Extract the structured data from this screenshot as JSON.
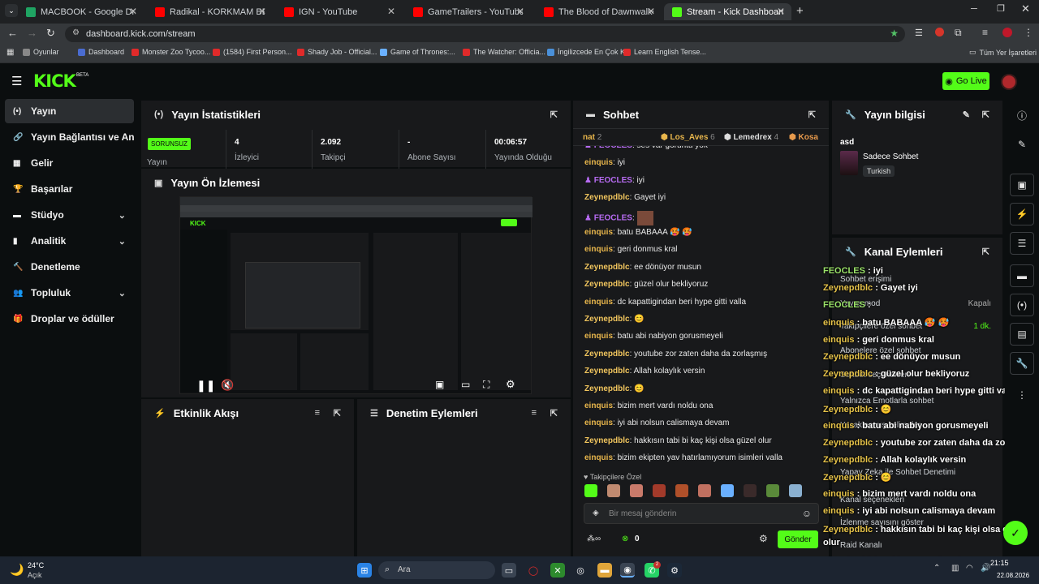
{
  "browser": {
    "tabs": [
      {
        "label": "MACBOOK - Google Drive",
        "color": "#1fa463"
      },
      {
        "label": "Radikal - KORKMAM BEN - You",
        "color": "#ff0000"
      },
      {
        "label": "IGN - YouTube",
        "color": "#ff0000"
      },
      {
        "label": "GameTrailers - YouTube",
        "color": "#ff0000"
      },
      {
        "label": "The Blood of Dawnwalker - Off",
        "color": "#ff0000"
      },
      {
        "label": "Stream - Kick Dashboard",
        "color": "#53fc18"
      }
    ],
    "url": "dashboard.kick.com/stream",
    "bookmarks": [
      "Oyunlar",
      "Dashboard",
      "Monster Zoo Tycoo...",
      "(1584) First Person...",
      "Shady Job - Official...",
      "Game of Thrones:...",
      "The Watcher: Officia...",
      "İngilizcede En Çok K...",
      "Learn English Tense..."
    ],
    "all_bookmarks": "Tüm Yer İşaretleri"
  },
  "kick": {
    "logo": "KICK",
    "logo_sup": "BETA",
    "go_live": "Go Live",
    "accent": "#53fc18"
  },
  "sidebar": {
    "items": [
      {
        "label": "Yayın",
        "icon": "broadcast-icon",
        "chev": false
      },
      {
        "label": "Yayın Bağlantısı ve Anahtar",
        "icon": "link-icon",
        "chev": false
      },
      {
        "label": "Gelir",
        "icon": "revenue-icon",
        "chev": false
      },
      {
        "label": "Başarılar",
        "icon": "trophy-icon",
        "chev": false
      },
      {
        "label": "Stüdyo",
        "icon": "studio-icon",
        "chev": true
      },
      {
        "label": "Analitik",
        "icon": "analytics-icon",
        "chev": true
      },
      {
        "label": "Denetleme",
        "icon": "hammer-icon",
        "chev": false
      },
      {
        "label": "Topluluk",
        "icon": "community-icon",
        "chev": true
      },
      {
        "label": "Droplar ve ödüller",
        "icon": "gift-icon",
        "chev": false
      }
    ]
  },
  "stats": {
    "title": "Yayın İstatistikleri",
    "status_badge": "SORUNSUZ",
    "status_label": "Yayın",
    "items": [
      {
        "value": "4",
        "label": "İzleyici"
      },
      {
        "value": "2.092",
        "label": "Takipçi"
      },
      {
        "value": "-",
        "label": "Abone Sayısı"
      },
      {
        "value": "00:06:57",
        "label": "Yayında Olduğu"
      }
    ]
  },
  "preview": {
    "title": "Yayın Ön İzlemesi"
  },
  "activity": {
    "title": "Etkinlik Akışı"
  },
  "moderation": {
    "title": "Denetim Eylemleri"
  },
  "chat": {
    "title": "Sohbet",
    "top_gifters": [
      {
        "name": "nat",
        "count": "2"
      },
      {
        "name": "Los_Aves",
        "count": "6"
      },
      {
        "name": "Lemedrex",
        "count": "4"
      },
      {
        "name": "Kosa",
        "count": ""
      }
    ],
    "messages": [
      {
        "user": "FEOCLES",
        "text": "ses var görüntü yok",
        "badge": true
      },
      {
        "user": "einquis",
        "text": "iyi",
        "badge": false
      },
      {
        "user": "FEOCLES",
        "text": "iyi",
        "badge": true
      },
      {
        "user": "Zeynepdblc",
        "text": "Gayet iyi",
        "badge": false
      },
      {
        "user": "FEOCLES",
        "text": "",
        "badge": true,
        "emote": true
      },
      {
        "user": "einquis",
        "text": "batu BABAAA 🥵 🥵",
        "badge": false
      },
      {
        "user": "einquis",
        "text": "geri donmus kral",
        "badge": false
      },
      {
        "user": "Zeynepdblc",
        "text": "ee dönüyor musun",
        "badge": false
      },
      {
        "user": "Zeynepdblc",
        "text": "güzel olur bekliyoruz",
        "badge": false
      },
      {
        "user": "einquis",
        "text": "dc kapattigindan beri hype gitti valla",
        "badge": false
      },
      {
        "user": "Zeynepdblc",
        "text": "😊",
        "badge": false
      },
      {
        "user": "einquis",
        "text": "batu abi nabiyon gorusmeyeli",
        "badge": false
      },
      {
        "user": "Zeynepdblc",
        "text": "youtube zor zaten daha da zorlaşmış",
        "badge": false
      },
      {
        "user": "Zeynepdblc",
        "text": "Allah kolaylık versin",
        "badge": false
      },
      {
        "user": "Zeynepdblc",
        "text": "😊",
        "badge": false
      },
      {
        "user": "einquis",
        "text": "bizim mert vardı noldu ona",
        "badge": false
      },
      {
        "user": "einquis",
        "text": "iyi abi nolsun calismaya devam",
        "badge": false
      },
      {
        "user": "Zeynepdblc",
        "text": "hakkısın tabi bi kaç kişi olsa güzel olur",
        "badge": false
      },
      {
        "user": "einquis",
        "text": "bizim ekipten yav hatırlamıyorum isimleri valla",
        "badge": false
      }
    ],
    "followers_only": "Takipçilere Özel",
    "input_placeholder": "Bir mesaj gönderin",
    "points": "0",
    "send": "Gönder"
  },
  "stream_info": {
    "title": "Yayın bilgisi",
    "stream_title": "asd",
    "category": "Sadece Sohbet",
    "language": "Turkish"
  },
  "channel_actions": {
    "title": "Kanal Eylemleri",
    "rows": [
      {
        "label": "Sohbet erişimi",
        "value": ""
      },
      {
        "label": "Yavaş mod",
        "value": "Kapalı"
      },
      {
        "label": "Takipçilere özel sohbet",
        "value": "1 dk."
      },
      {
        "label": "Abonelere özel sohbet",
        "value": ""
      },
      {
        "label": "Sohbet seçenekleri",
        "value": ""
      },
      {
        "label": "Yalnızca Emotlarla sohbet",
        "value": ""
      },
      {
        "label": "Yasaklanmış kelimeler",
        "value": ""
      },
      {
        "label": "Yapay Zeka ile Sohbet Denetimi",
        "value": ""
      },
      {
        "label": "Kanal seçenekleri",
        "value": ""
      },
      {
        "label": "İzlenme sayısını göster",
        "value": ""
      },
      {
        "label": "Raid Kanalı",
        "value": ""
      }
    ]
  },
  "overlay_chat": [
    {
      "user": "FEOCLES",
      "text": ": iyi"
    },
    {
      "user": "Zeynepdblc",
      "text": ": Gayet iyi"
    },
    {
      "user": "FEOCLES",
      "text": ":"
    },
    {
      "user": "einquis",
      "text": ": batu BABAAA 🥵 🥵"
    },
    {
      "user": "einquis",
      "text": ": geri donmus kral"
    },
    {
      "user": "Zeynepdblc",
      "text": ": ee dönüyor musun"
    },
    {
      "user": "Zeynepdblc",
      "text": ": güzel olur bekliyoruz"
    },
    {
      "user": "einquis",
      "text": ": dc kapattigindan beri hype gitti valla"
    },
    {
      "user": "Zeynepdblc",
      "text": ": 😊"
    },
    {
      "user": "einquis",
      "text": ": batu abi nabiyon gorusmeyeli"
    },
    {
      "user": "Zeynepdblc",
      "text": ": youtube zor zaten daha da zorlaşmış"
    },
    {
      "user": "Zeynepdblc",
      "text": ": Allah kolaylık versin"
    },
    {
      "user": "Zeynepdblc",
      "text": ": 😊"
    },
    {
      "user": "einquis",
      "text": ": bizim mert vardı noldu ona"
    },
    {
      "user": "einquis",
      "text": ": iyi abi nolsun calismaya devam"
    },
    {
      "user": "Zeynepdblc",
      "text": ": hakkısın tabi bi kaç kişi olsa güzel olur"
    },
    {
      "user": "einquis",
      "text": ": bizim ekipten yav hatırlamıyorum isimleri valla"
    }
  ],
  "taskbar": {
    "weather_temp": "24°C",
    "weather_desc": "Açık",
    "search": "Ara",
    "time": "21:15",
    "date": "22.08.2026",
    "notif_count": "2"
  }
}
